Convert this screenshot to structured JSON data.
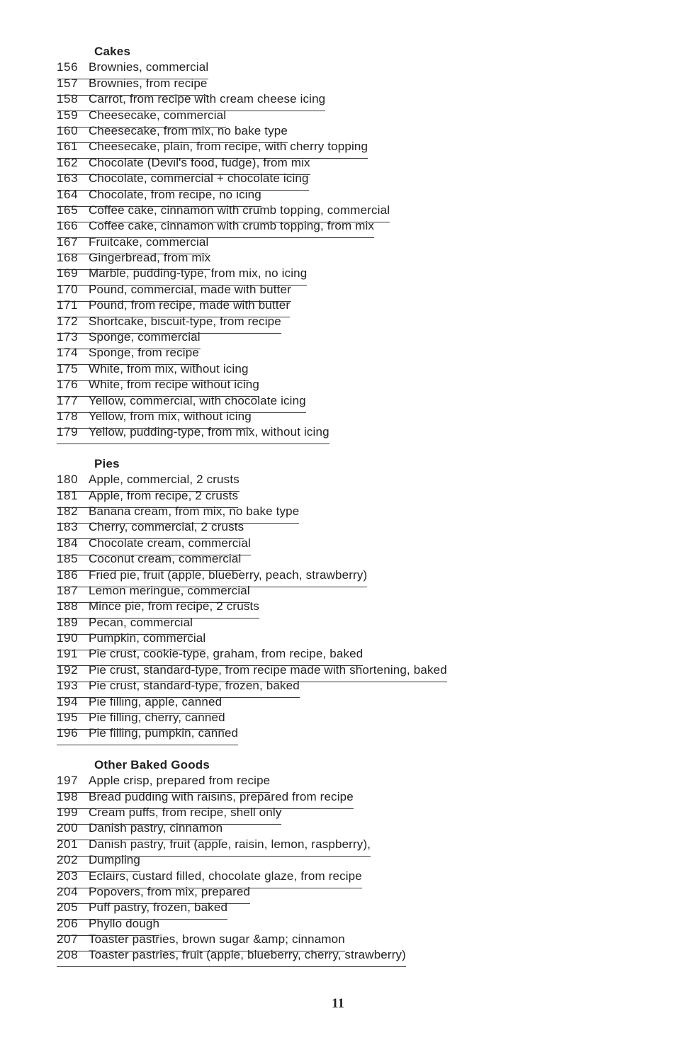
{
  "page": {
    "number": "11",
    "background_color": "#ffffff",
    "text_color": "#231f20",
    "rule_color": "#3a3738"
  },
  "sections": [
    {
      "heading": "Cakes",
      "entries": [
        {
          "number": "156",
          "label": "Brownies, commercial"
        },
        {
          "number": "157",
          "label": "Brownies, from recipe"
        },
        {
          "number": "158",
          "label": "Carrot, from recipe with cream cheese icing"
        },
        {
          "number": "159",
          "label": "Cheesecake, commercial"
        },
        {
          "number": "160",
          "label": "Cheesecake, from mix, no bake type"
        },
        {
          "number": "161",
          "label": "Cheesecake, plain, from recipe, with cherry topping"
        },
        {
          "number": "162",
          "label": "Chocolate (Devil's food, fudge), from mix"
        },
        {
          "number": "163",
          "label": "Chocolate, commercial + chocolate icing"
        },
        {
          "number": "164",
          "label": "Chocolate, from recipe, no icing"
        },
        {
          "number": "165",
          "label": "Coffee cake, cinnamon with crumb topping, commercial"
        },
        {
          "number": "166",
          "label": "Coffee cake, cinnamon with crumb topping, from mix"
        },
        {
          "number": "167",
          "label": "Fruitcake, commercial"
        },
        {
          "number": "168",
          "label": "Gingerbread, from mix"
        },
        {
          "number": "169",
          "label": "Marble, pudding-type, from mix, no icing"
        },
        {
          "number": "170",
          "label": "Pound, commercial, made with butter"
        },
        {
          "number": "171",
          "label": "Pound, from recipe, made with butter"
        },
        {
          "number": "172",
          "label": "Shortcake, biscuit-type, from recipe"
        },
        {
          "number": "173",
          "label": "Sponge, commercial"
        },
        {
          "number": "174",
          "label": "Sponge, from recipe"
        },
        {
          "number": "175",
          "label": "White, from mix, without icing"
        },
        {
          "number": "176",
          "label": "White, from recipe without icing"
        },
        {
          "number": "177",
          "label": "Yellow, commercial, with chocolate icing"
        },
        {
          "number": "178",
          "label": "Yellow, from mix, without icing"
        },
        {
          "number": "179",
          "label": "Yellow, pudding-type, from mix, without icing"
        }
      ]
    },
    {
      "heading": "Pies",
      "entries": [
        {
          "number": "180",
          "label": "Apple, commercial, 2 crusts"
        },
        {
          "number": "181",
          "label": "Apple, from recipe, 2 crusts"
        },
        {
          "number": "182",
          "label": "Banana cream, from mix, no bake type"
        },
        {
          "number": "183",
          "label": "Cherry, commercial, 2 crusts"
        },
        {
          "number": "184",
          "label": "Chocolate cream, commercial"
        },
        {
          "number": "185",
          "label": "Coconut cream, commercial"
        },
        {
          "number": "186",
          "label": "Fried pie, fruit (apple, blueberry, peach, strawberry)"
        },
        {
          "number": "187",
          "label": "Lemon meringue, commercial"
        },
        {
          "number": "188",
          "label": "Mince pie, from recipe, 2 crusts"
        },
        {
          "number": "189",
          "label": "Pecan, commercial"
        },
        {
          "number": "190",
          "label": "Pumpkin, commercial"
        },
        {
          "number": "191",
          "label": "Pie crust, cookie-type, graham, from recipe, baked"
        },
        {
          "number": "192",
          "label": "Pie crust, standard-type, from recipe made with shortening, baked"
        },
        {
          "number": "193",
          "label": "Pie crust, standard-type, frozen, baked"
        },
        {
          "number": "194",
          "label": "Pie filling, apple, canned"
        },
        {
          "number": "195",
          "label": "Pie filling, cherry, canned"
        },
        {
          "number": "196",
          "label": "Pie filling, pumpkin, canned"
        }
      ]
    },
    {
      "heading": "Other Baked Goods",
      "entries": [
        {
          "number": "197",
          "label": "Apple crisp, prepared from recipe"
        },
        {
          "number": "198",
          "label": "Bread pudding with raisins, prepared from recipe"
        },
        {
          "number": "199",
          "label": "Cream puffs, from recipe, shell only"
        },
        {
          "number": "200",
          "label": "Danish pastry, cinnamon"
        },
        {
          "number": "201",
          "label": "Danish pastry, fruit (apple, raisin, lemon, raspberry),"
        },
        {
          "number": "202",
          "label": "Dumpling"
        },
        {
          "number": "203",
          "label": "Eclairs, custard filled, chocolate glaze, from recipe"
        },
        {
          "number": "204",
          "label": "Popovers, from mix, prepared"
        },
        {
          "number": "205",
          "label": "Puff pastry, frozen, baked"
        },
        {
          "number": "206",
          "label": "Phyllo dough"
        },
        {
          "number": "207",
          "label": "Toaster pastries, brown sugar &amp; cinnamon"
        },
        {
          "number": "208",
          "label": "Toaster pastries, fruit (apple, blueberry, cherry, strawberry)"
        }
      ]
    }
  ]
}
